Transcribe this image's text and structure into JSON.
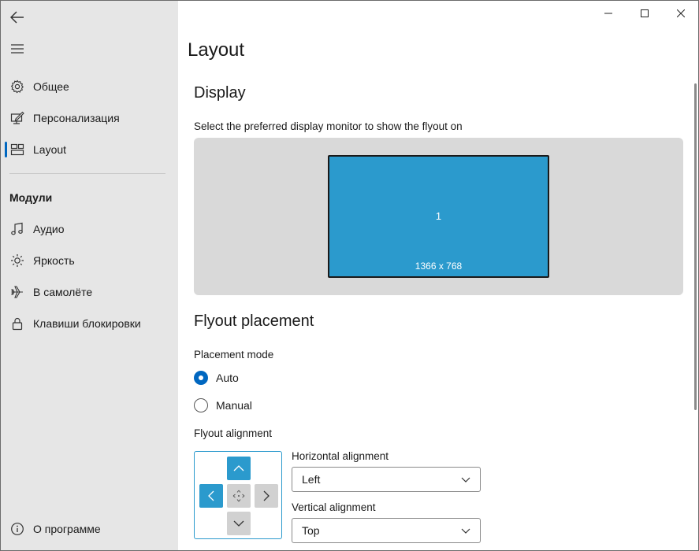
{
  "sidebar": {
    "items": [
      {
        "label": "Общее",
        "icon": "gear-icon"
      },
      {
        "label": "Персонализация",
        "icon": "personalize-icon"
      },
      {
        "label": "Layout",
        "icon": "layout-icon",
        "selected": true
      }
    ],
    "modules_header": "Модули",
    "modules": [
      {
        "label": "Аудио",
        "icon": "music-note-icon"
      },
      {
        "label": "Яркость",
        "icon": "brightness-icon"
      },
      {
        "label": "В самолёте",
        "icon": "airplane-icon"
      },
      {
        "label": "Клавиши блокировки",
        "icon": "lock-icon"
      }
    ],
    "about": {
      "label": "О программе",
      "icon": "info-icon"
    }
  },
  "page": {
    "title": "Layout",
    "display": {
      "header": "Display",
      "caption": "Select the preferred display monitor to show the flyout on",
      "monitor": {
        "number": "1",
        "resolution": "1366 x 768"
      }
    },
    "placement": {
      "header": "Flyout placement",
      "mode_label": "Placement mode",
      "modes": [
        {
          "label": "Auto",
          "checked": true
        },
        {
          "label": "Manual",
          "checked": false
        }
      ],
      "alignment_label": "Flyout alignment",
      "horizontal_label": "Horizontal alignment",
      "horizontal_value": "Left",
      "vertical_label": "Vertical alignment",
      "vertical_value": "Top"
    }
  },
  "colors": {
    "accent": "#0067c0",
    "monitor_fill": "#2b9acd",
    "sidebar_bg": "#e6e6e6"
  }
}
